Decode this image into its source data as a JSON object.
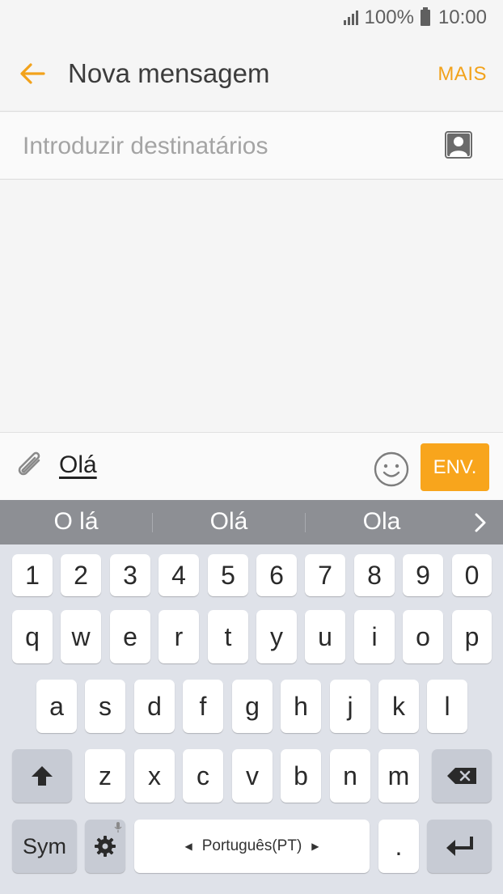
{
  "status_bar": {
    "battery": "100%",
    "time": "10:00"
  },
  "header": {
    "title": "Nova mensagem",
    "more_label": "MAIS"
  },
  "recipients": {
    "placeholder": "Introduzir destinatários"
  },
  "composer": {
    "message_text": "Olá",
    "send_label": "ENV."
  },
  "suggestions": [
    "O lá",
    "Olá",
    "Ola"
  ],
  "keyboard": {
    "number_row": [
      "1",
      "2",
      "3",
      "4",
      "5",
      "6",
      "7",
      "8",
      "9",
      "0"
    ],
    "row1": [
      "q",
      "w",
      "e",
      "r",
      "t",
      "y",
      "u",
      "i",
      "o",
      "p"
    ],
    "row2": [
      "a",
      "s",
      "d",
      "f",
      "g",
      "h",
      "j",
      "k",
      "l"
    ],
    "row3": [
      "z",
      "x",
      "c",
      "v",
      "b",
      "n",
      "m"
    ],
    "sym_label": "Sym",
    "space_label": "Português(PT)",
    "period_label": "."
  },
  "colors": {
    "accent": "#f2a21b",
    "send_bg": "#f8a51c",
    "suggestion_bar": "#8d8f94",
    "keyboard_bg": "#dfe2e9"
  },
  "icons": [
    "back-arrow-icon",
    "contact-icon",
    "paperclip-icon",
    "emoji-icon",
    "chevron-right-icon",
    "shift-icon",
    "backspace-icon",
    "settings-icon",
    "mic-icon",
    "enter-icon"
  ]
}
